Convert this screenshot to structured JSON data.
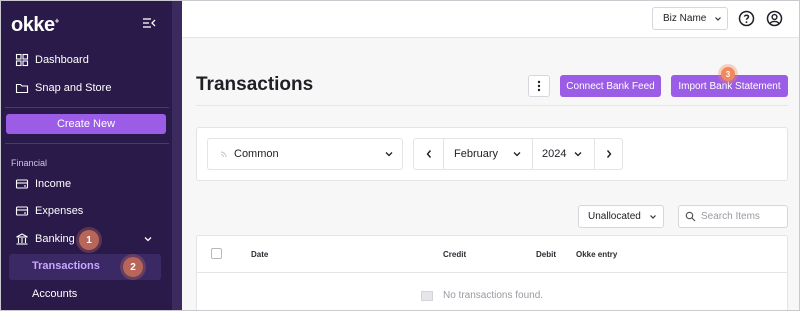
{
  "sidebar": {
    "logo": "okke",
    "logo_mark": "+",
    "items_top": [
      {
        "label": "Dashboard",
        "icon": "grid-icon"
      },
      {
        "label": "Snap and Store",
        "icon": "folder-icon"
      }
    ],
    "create_new": "Create New",
    "section": "Financial",
    "items_financial": [
      {
        "label": "Income",
        "icon": "receipt-icon"
      },
      {
        "label": "Expenses",
        "icon": "receipt-icon"
      },
      {
        "label": "Banking",
        "icon": "bank-icon"
      }
    ],
    "sub_items": [
      {
        "label": "Transactions",
        "active": true
      },
      {
        "label": "Accounts",
        "active": false
      }
    ],
    "badges": [
      "1",
      "2"
    ]
  },
  "topbar": {
    "business": "Biz Name",
    "icons": [
      "help-icon",
      "user-icon"
    ]
  },
  "main": {
    "title": "Transactions",
    "buttons": {
      "connect": "Connect Bank Feed",
      "import": "Import Bank Statement"
    },
    "badge3": "3",
    "filters": {
      "category": "Common",
      "month": "February",
      "year": "2024"
    },
    "allocation_filter": "Unallocated",
    "search_placeholder": "Search Items",
    "table": {
      "columns": [
        "Date",
        "Credit",
        "Debit",
        "Okke entry"
      ],
      "empty_message": "No transactions found."
    }
  },
  "colors": {
    "sidebar_bg": "#2a1a4a",
    "accent": "#9b5de5",
    "badge": "#b8665a",
    "badge3": "#f08a5d"
  }
}
